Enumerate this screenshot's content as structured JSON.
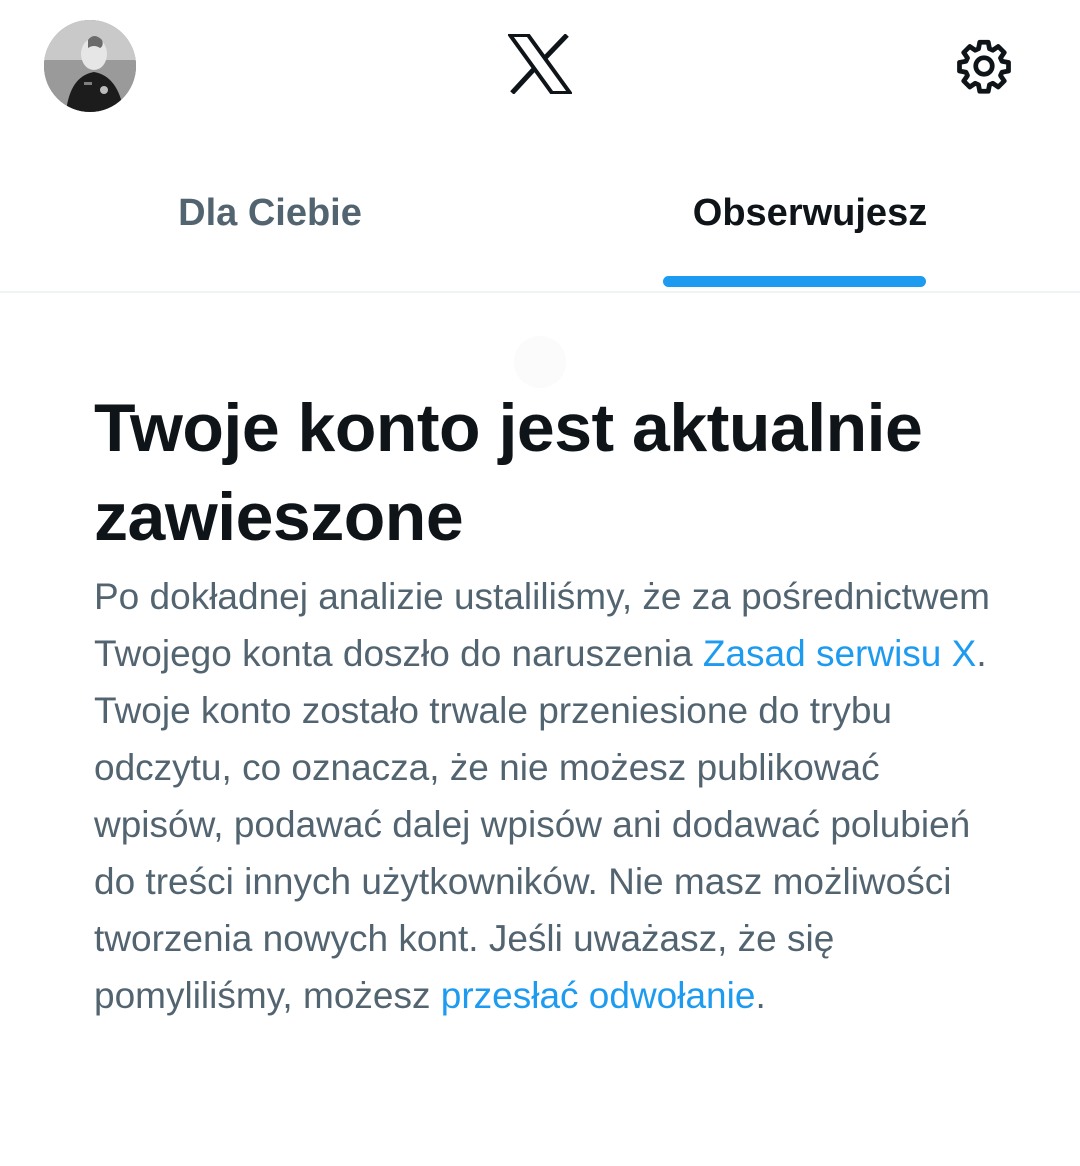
{
  "header": {
    "avatar_icon": "profile-avatar",
    "logo_icon": "x-logo-icon",
    "settings_icon": "gear-icon"
  },
  "tabs": [
    {
      "label": "Dla Ciebie",
      "active": false
    },
    {
      "label": "Obserwujesz",
      "active": true
    }
  ],
  "colors": {
    "accent": "#1d9bf0",
    "text_primary": "#0f1419",
    "text_secondary": "#536471"
  },
  "notice": {
    "title": "Twoje konto jest aktualnie zawieszone",
    "body_part1": "Po dokładnej analizie ustaliliśmy, że za pośrednictwem Twojego konta doszło do naruszenia ",
    "link1": "Zasad serwisu X",
    "body_part2": ". Twoje konto zostało trwale przeniesione do trybu odczytu, co oznacza, że nie możesz publikować wpisów, podawać dalej wpisów ani dodawać polubień do treści innych użytkowników. Nie masz możliwości tworzenia nowych kont. Jeśli uważasz, że się pomyliliśmy, możesz ",
    "link2": "przesłać odwołanie",
    "body_part3": "."
  }
}
